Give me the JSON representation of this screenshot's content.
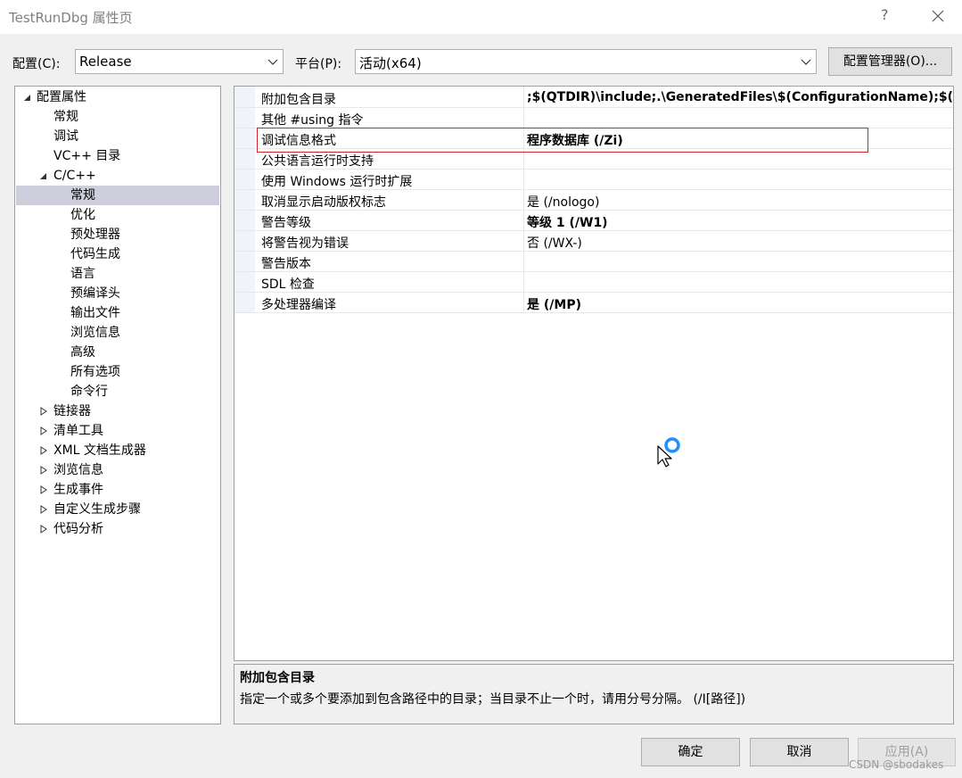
{
  "window": {
    "title": "TestRunDbg 属性页",
    "help": "?"
  },
  "toolbar": {
    "config_label": "配置(C):",
    "config_value": "Release",
    "platform_label": "平台(P):",
    "platform_value": "活动(x64)",
    "manager_button": "配置管理器(O)..."
  },
  "tree": {
    "root": "配置属性",
    "items": [
      "常规",
      "调试",
      "VC++ 目录"
    ],
    "cpp": "C/C++",
    "cpp_items": [
      "常规",
      "优化",
      "预处理器",
      "代码生成",
      "语言",
      "预编译头",
      "输出文件",
      "浏览信息",
      "高级",
      "所有选项",
      "命令行"
    ],
    "collapsed": [
      "链接器",
      "清单工具",
      "XML 文档生成器",
      "浏览信息",
      "生成事件",
      "自定义生成步骤",
      "代码分析"
    ],
    "selected": "常规"
  },
  "properties": [
    {
      "name": "附加包含目录",
      "value": ";$(QTDIR)\\include;.\\GeneratedFiles\\$(ConfigurationName);$(QT",
      "bold": true
    },
    {
      "name": "其他 #using 指令",
      "value": "",
      "bold": false
    },
    {
      "name": "调试信息格式",
      "value": "程序数据库 (/Zi)",
      "bold": true
    },
    {
      "name": "公共语言运行时支持",
      "value": "",
      "bold": false
    },
    {
      "name": "使用 Windows 运行时扩展",
      "value": "",
      "bold": false
    },
    {
      "name": "取消显示启动版权标志",
      "value": "是 (/nologo)",
      "bold": false
    },
    {
      "name": "警告等级",
      "value": "等级 1 (/W1)",
      "bold": true
    },
    {
      "name": "将警告视为错误",
      "value": "否 (/WX-)",
      "bold": false
    },
    {
      "name": "警告版本",
      "value": "",
      "bold": false
    },
    {
      "name": "SDL 检查",
      "value": "",
      "bold": false
    },
    {
      "name": "多处理器编译",
      "value": "是 (/MP)",
      "bold": true
    }
  ],
  "description": {
    "title": "附加包含目录",
    "text": "指定一个或多个要添加到包含路径中的目录；当目录不止一个时，请用分号分隔。     (/I[路径])"
  },
  "buttons": {
    "ok": "确定",
    "cancel": "取消",
    "apply": "应用(A)"
  },
  "watermark": "CSDN @sbodakes",
  "colors": {
    "highlight_border": "#d0232a",
    "tree_selection": "#cccedb",
    "cursor_ring": "#1e90ff"
  }
}
